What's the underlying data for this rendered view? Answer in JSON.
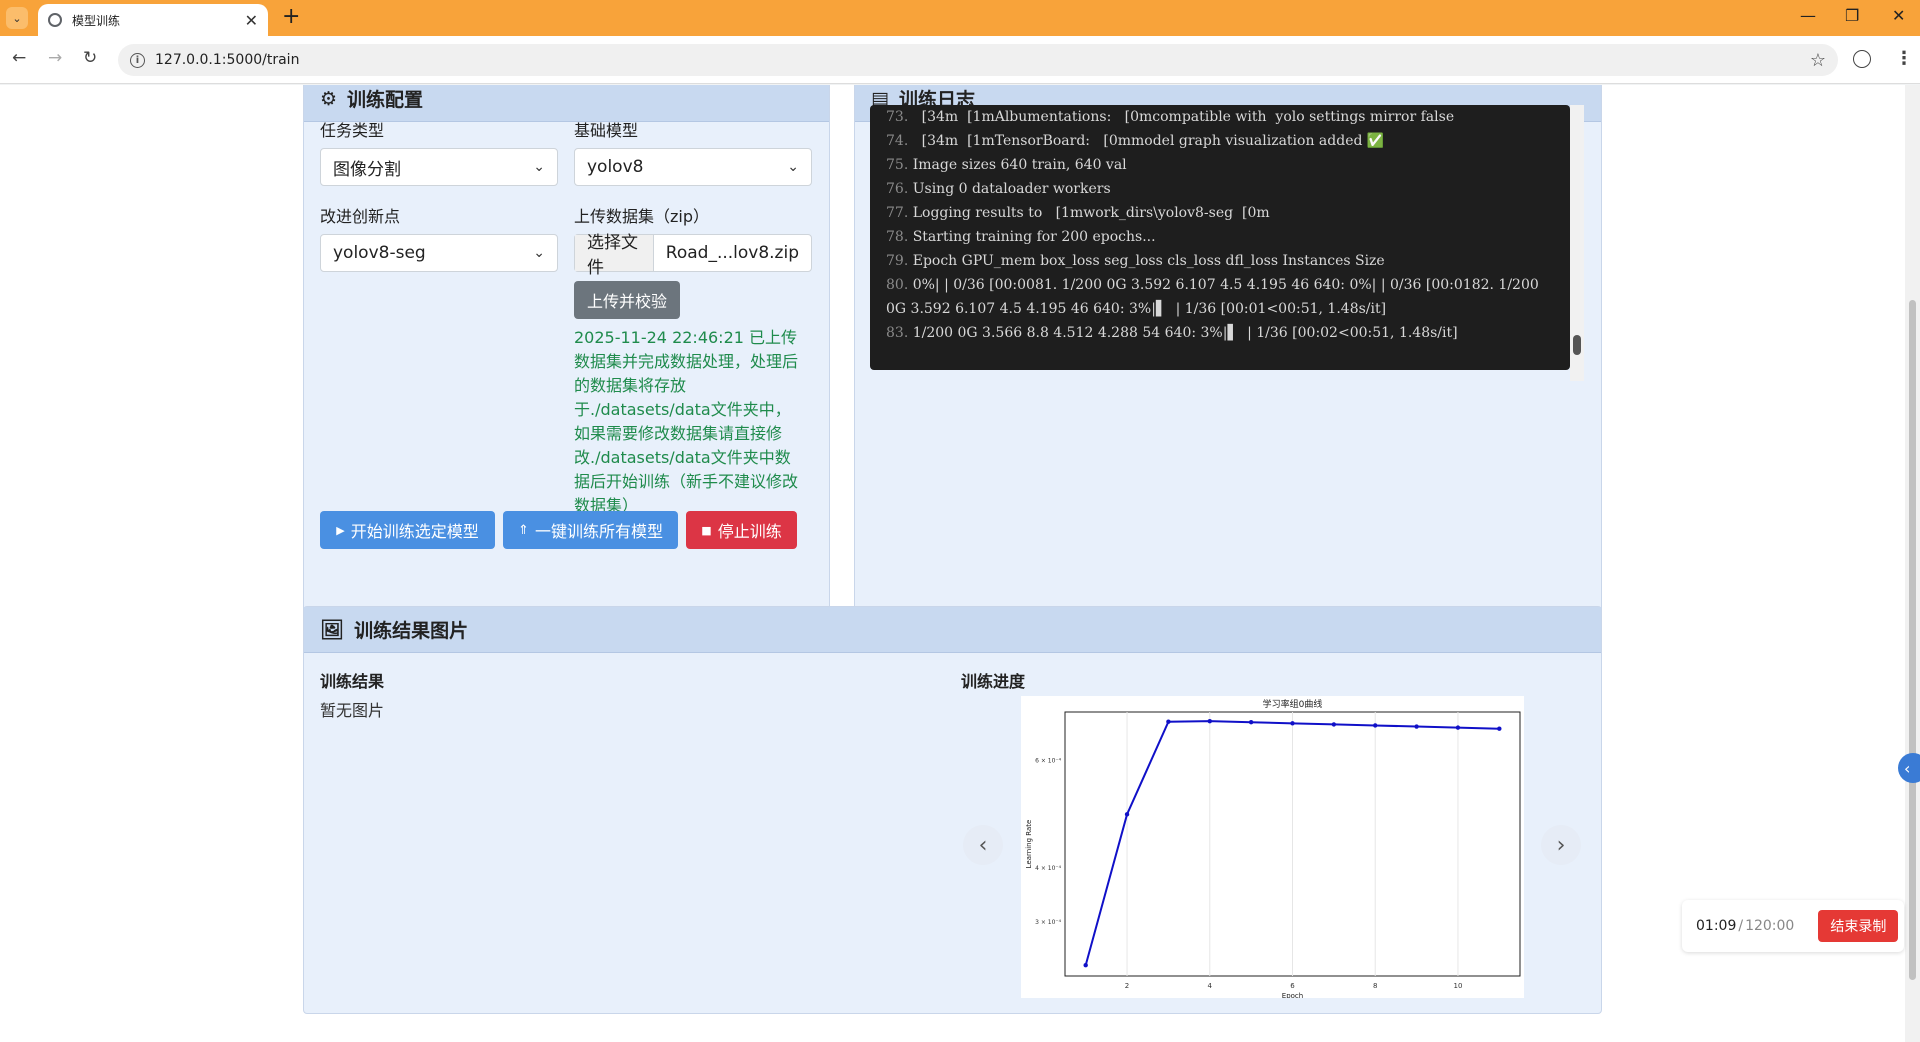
{
  "browser": {
    "tab_title": "模型训练",
    "url": "127.0.0.1:5000/train"
  },
  "config": {
    "header_title": "训练配置",
    "task_type_label": "任务类型",
    "task_type_value": "图像分割",
    "base_model_label": "基础模型",
    "base_model_value": "yolov8",
    "improvement_label": "改进创新点",
    "improvement_value": "yolov8-seg",
    "dataset_label": "上传数据集（zip）",
    "choose_file_label": "选择文件",
    "file_name": "Road_...lov8.zip",
    "upload_button": "上传并校验",
    "upload_status": "2025-11-24 22:46:21 已上传数据集并完成数据处理，处理后的数据集将存放于./datasets/data文件夹中，如果需要修改数据集请直接修改./datasets/data文件夹中数据后开始训练（新手不建议修改数据集）",
    "start_button": "开始训练选定模型",
    "train_all_button": "一键训练所有模型",
    "stop_button": "停止训练"
  },
  "log": {
    "header_title": "训练日志",
    "lines": [
      {
        "ln": "73.",
        "text": "  [34m  [1mAlbumentations:   [0mcompatible with  yolo settings mirror false"
      },
      {
        "ln": "74.",
        "text": "  [34m  [1mTensorBoard:   [0mmodel graph visualization added ✅"
      },
      {
        "ln": "75.",
        "text": "Image sizes 640 train, 640 val"
      },
      {
        "ln": "76.",
        "text": "Using 0 dataloader workers"
      },
      {
        "ln": "77.",
        "text": "Logging results to   [1mwork_dirs\\yolov8-seg  [0m"
      },
      {
        "ln": "78.",
        "text": "Starting training for 200 epochs..."
      },
      {
        "ln": "79.",
        "text": "Epoch GPU_mem box_loss seg_loss cls_loss dfl_loss Instances Size"
      },
      {
        "ln": "80.",
        "text": "0%| | 0/36 [00:0081. 1/200 0G 3.592 6.107 4.5 4.195 46 640: 0%| | 0/36 [00:0182. 1/200 0G 3.592 6.107 4.5 4.195 46 640: 3%|▌  | 1/36 [00:01<00:51, 1.48s/it]"
      },
      {
        "ln": "83.",
        "text": "1/200 0G 3.566 8.8 4.512 4.288 54 640: 3%|▌  | 1/36 [00:02<00:51, 1.48s/it]"
      }
    ]
  },
  "results": {
    "header_title": "训练结果图片",
    "result_label": "训练结果",
    "no_image": "暂无图片",
    "progress_label": "训练进度"
  },
  "chart_data": {
    "type": "line",
    "title": "学习率组0曲线",
    "xlabel": "Epoch",
    "ylabel": "Learning Rate",
    "x": [
      1,
      2,
      3,
      4,
      5,
      6,
      7,
      8,
      9,
      10,
      11
    ],
    "series": [
      {
        "values": [
          0.00022,
          0.0005,
          0.000672,
          0.000673,
          0.000671,
          0.000669,
          0.000667,
          0.000665,
          0.000663,
          0.000661,
          0.000659
        ]
      }
    ],
    "x_ticks": [
      "2",
      "4",
      "6",
      "8",
      "10"
    ],
    "y_ticks": [
      {
        "v": 0.0003,
        "label": "3 × 10⁻⁴"
      },
      {
        "v": 0.0004,
        "label": "4 × 10⁻⁴"
      },
      {
        "v": 0.0006,
        "label": "6 × 10⁻⁴"
      }
    ],
    "xlim": [
      0.5,
      11.5
    ],
    "ylim": [
      0.0002,
      0.00069
    ],
    "grid": true,
    "color": "#1010c8"
  },
  "recorder": {
    "elapsed": "01:09",
    "separator": " / ",
    "total": "120:00",
    "end_button": "结束录制"
  }
}
